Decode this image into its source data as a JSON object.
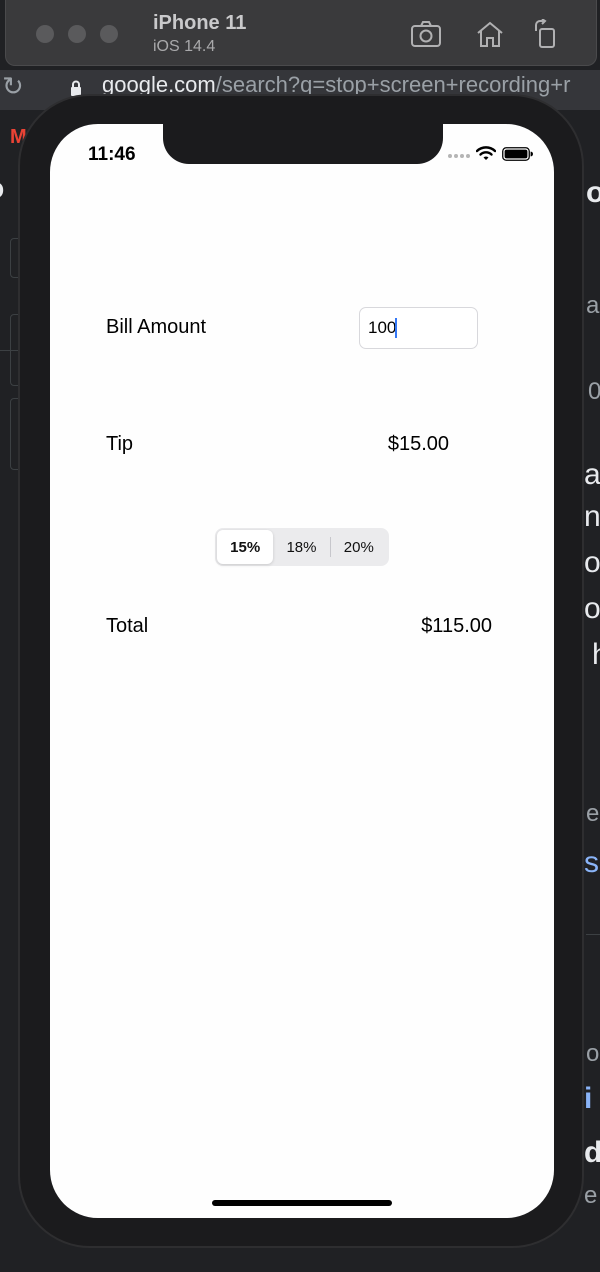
{
  "simulator": {
    "device_name": "iPhone 11",
    "os_version": "iOS 14.4",
    "buttons": [
      "screenshot-icon",
      "home-icon",
      "rotate-icon"
    ]
  },
  "browser": {
    "url_host": "google.com",
    "url_rest": "/search?q=stop+screen+recording+r"
  },
  "status_bar": {
    "time": "11:46"
  },
  "app": {
    "bill_label": "Bill Amount",
    "bill_value": "100",
    "tip_label": "Tip",
    "tip_value": "$15.00",
    "total_label": "Total",
    "total_value": "$115.00",
    "tip_options": [
      "15%",
      "18%",
      "20%"
    ],
    "selected_tip": "15%"
  },
  "colors": {
    "caret": "#3478f6",
    "background": "#fefefe",
    "device_bezel": "#1b1b1d"
  }
}
